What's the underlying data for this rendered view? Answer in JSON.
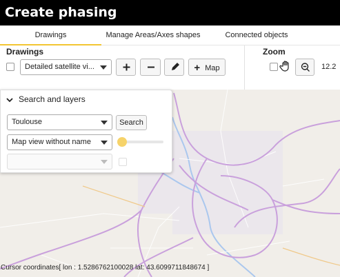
{
  "title": "Create phasing",
  "tabs": [
    {
      "label": "Drawings"
    },
    {
      "label": "Manage Areas/Axes shapes"
    },
    {
      "label": "Connected objects"
    }
  ],
  "drawings": {
    "heading": "Drawings",
    "layer_select": "Detailed satellite vi...",
    "map_button": "Map"
  },
  "zoom": {
    "heading": "Zoom",
    "level": "12.2"
  },
  "layers_panel": {
    "heading": "Search and layers",
    "city_select": "Toulouse",
    "search_button": "Search",
    "view_select": "Map view without name",
    "empty_select": "",
    "opacity_level": 0.0
  },
  "status": {
    "cursor": "Cursor coordinates[ lon : 1.5286762100028 lat: 43.6099711848674 ]"
  },
  "colors": {
    "accent": "#f2c531",
    "road_major": "#c9a0dc",
    "water": "#aac7ee",
    "land": "#f1eee9"
  }
}
